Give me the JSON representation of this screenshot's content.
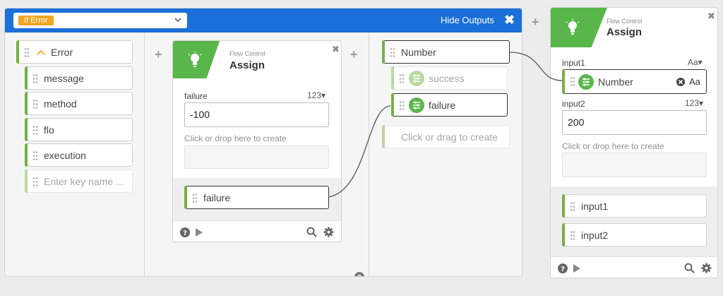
{
  "scope": {
    "badge": "If Error",
    "hide_outputs_label": "Hide Outputs",
    "close_glyph": "✖",
    "error_group": {
      "label": "Error",
      "keys": [
        "message",
        "method",
        "flo",
        "execution"
      ],
      "placeholder": "Enter key name ..."
    },
    "assign_tile": {
      "category": "Flow Control",
      "title": "Assign",
      "field_label": "failure",
      "field_type": "123▾",
      "field_value": "-100",
      "create_hint": "Click or drop here to create",
      "output_label": "failure"
    },
    "outputs_column": {
      "number_label": "Number",
      "success_label": "success",
      "failure_label": "failure",
      "create_label": "Click or drag to create"
    }
  },
  "right_tile": {
    "category": "Flow Control",
    "title": "Assign",
    "input1_label": "input1",
    "input1_type": "Aa▾",
    "input1_chip": "Number",
    "input1_chip_type": "Aa",
    "input2_label": "input2",
    "input2_type": "123▾",
    "input2_value": "200",
    "create_hint": "Click or drop here to create",
    "outputs": [
      "input1",
      "input2"
    ]
  },
  "icons": {
    "plus": "+",
    "tile_close": "✖"
  },
  "colors": {
    "scope_blue": "#1a6fd8",
    "badge_orange": "#f5a623",
    "flow_green": "#59b64a"
  }
}
